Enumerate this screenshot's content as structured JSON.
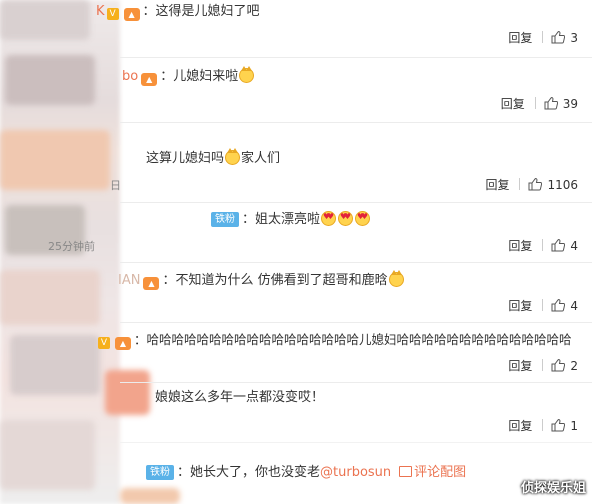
{
  "comments": [
    {
      "name": "K",
      "text": "：这得是儿媳妇了吧",
      "reply": "回复",
      "likes": "3"
    },
    {
      "name": "bo",
      "text": "：儿媳妇来啦",
      "reply": "回复",
      "likes": "39"
    },
    {
      "text": "这算儿媳妇吗",
      "text2": "家人们",
      "time": "日",
      "reply": "回复",
      "likes": "1106"
    },
    {
      "badge": "铁粉",
      "text": "：姐太漂亮啦",
      "time": "25分钟前",
      "reply": "回复",
      "likes": "4"
    },
    {
      "name": "IAN",
      "text": "：不知道为什么 仿佛看到了超哥和鹿晗",
      "reply": "回复",
      "likes": "4"
    },
    {
      "text": "：哈哈哈哈哈哈哈哈哈哈哈哈哈哈哈哈哈儿媳妇哈哈哈哈哈哈哈哈哈哈哈哈哈哈",
      "reply": "回复",
      "likes": "2"
    },
    {
      "text": "娘娘这么多年一点都没变哎！",
      "reply": "回复",
      "likes": "1"
    },
    {
      "badge": "铁粉",
      "text": "：她长大了，你也没变老",
      "mention": "@turbosun",
      "pic_link": "评论配图"
    }
  ],
  "watermark": "侦探娱乐姐",
  "icons": {
    "like": "thumbs-up-icon",
    "picture": "picture-icon"
  },
  "colors": {
    "name": "#eb7350",
    "fan_badge": "#5ab2e8",
    "v_badge": "#f6b01c"
  }
}
